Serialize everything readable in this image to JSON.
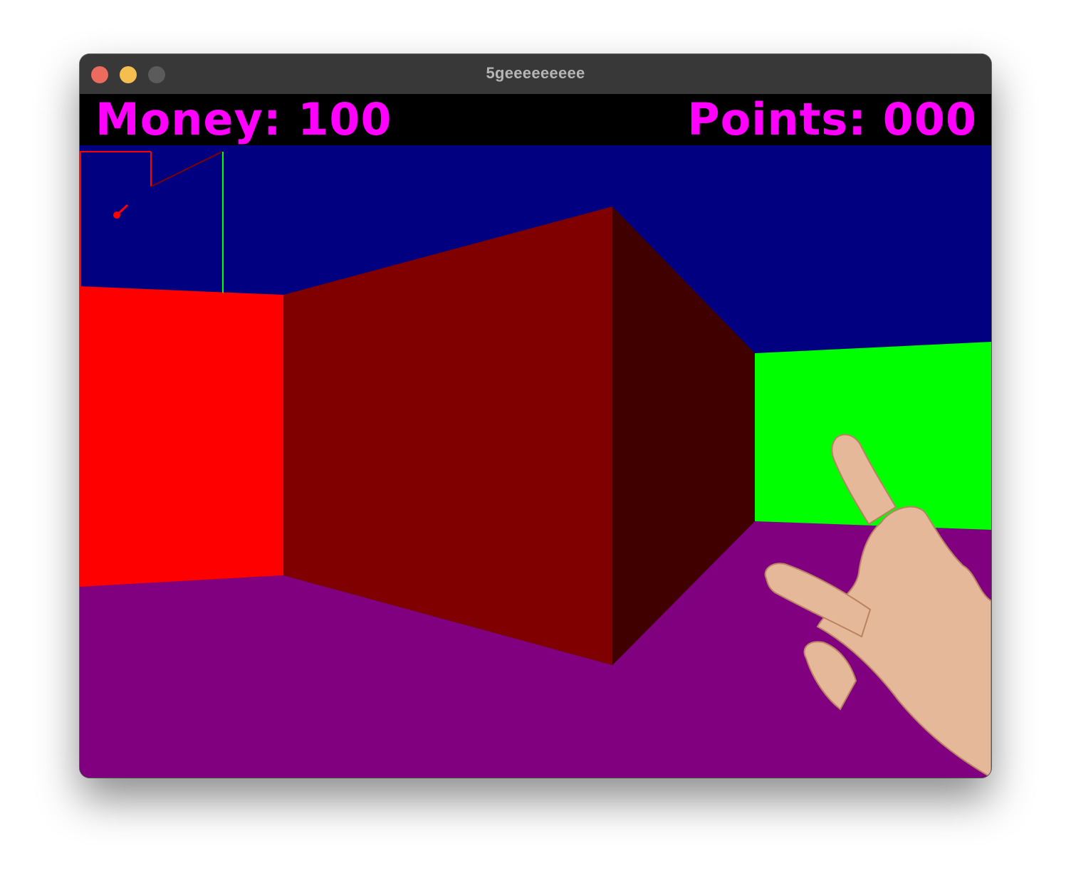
{
  "window": {
    "title": "5geeeeeeeee",
    "controls": {
      "close_color": "#ec6a5e",
      "minimize_color": "#f4bf4f",
      "zoom_color": "#5b5b5b"
    }
  },
  "hud": {
    "money_text": "Money: 100",
    "points_text": "Points: 000",
    "text_color": "#ff00ff",
    "background_color": "#000000"
  },
  "scene": {
    "ceiling_color": "#000080",
    "floor_color": "#800080",
    "walls": [
      {
        "name": "left-red-wall",
        "color": "#ff0000"
      },
      {
        "name": "center-dark-red-block-front",
        "color": "#800000"
      },
      {
        "name": "center-dark-red-block-side",
        "color": "#400000"
      },
      {
        "name": "right-green-wall",
        "color": "#00ff00"
      }
    ],
    "minimap": {
      "border_color": "#ff0000",
      "wall_line_color": "#800000",
      "side_line_color": "#00ff00",
      "player_color": "#ff0000"
    },
    "weapon": {
      "type": "hand-gesture",
      "skin_color": "#e6b89a"
    }
  }
}
